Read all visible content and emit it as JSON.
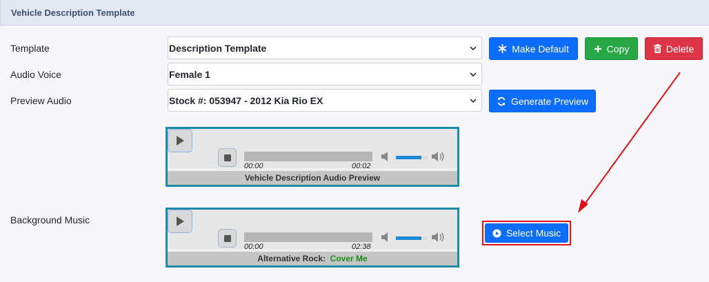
{
  "header": {
    "title": "Vehicle Description Template"
  },
  "form": {
    "template": {
      "label": "Template",
      "value": "Description Template"
    },
    "audio_voice": {
      "label": "Audio Voice",
      "value": "Female 1"
    },
    "preview_audio": {
      "label": "Preview Audio",
      "value": "Stock #: 053947 - 2012 Kia Rio EX"
    },
    "background_music": {
      "label": "Background Music"
    }
  },
  "buttons": {
    "make_default": "Make Default",
    "copy": "Copy",
    "delete": "Delete",
    "generate_preview": "Generate Preview",
    "select_music": "Select Music"
  },
  "preview_player": {
    "current_time": "00:00",
    "duration": "00:02",
    "volume": 0.8,
    "caption": "Vehicle Description Audio Preview"
  },
  "music_player": {
    "current_time": "00:00",
    "duration": "02:38",
    "volume": 0.8,
    "genre": "Alternative Rock:",
    "song": "Cover Me"
  },
  "colors": {
    "primary": "#0d6efd",
    "success": "#28a745",
    "danger": "#dc3545",
    "player_border": "#1f8aa6",
    "annotation_red": "#e2101b"
  }
}
